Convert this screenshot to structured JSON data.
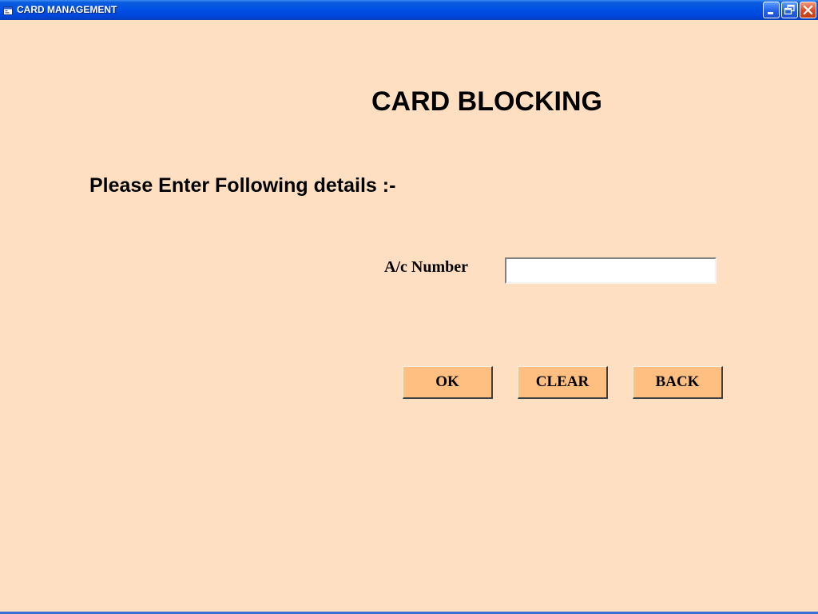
{
  "window": {
    "title": "CARD MANAGEMENT",
    "background_color": "#ffdfc2",
    "titlebar_color": "#0050e6",
    "icons": {
      "app": "app-window-icon",
      "minimize": "minimize-icon",
      "maximize": "restore-icon",
      "close": "close-icon"
    }
  },
  "form": {
    "heading": "CARD BLOCKING",
    "instruction": "Please Enter Following details :-",
    "account_label": "A/c Number",
    "account_value": "",
    "account_placeholder": ""
  },
  "buttons": {
    "ok_label": "OK",
    "clear_label": "CLEAR",
    "back_label": "BACK",
    "button_color": "#ffbf80"
  }
}
